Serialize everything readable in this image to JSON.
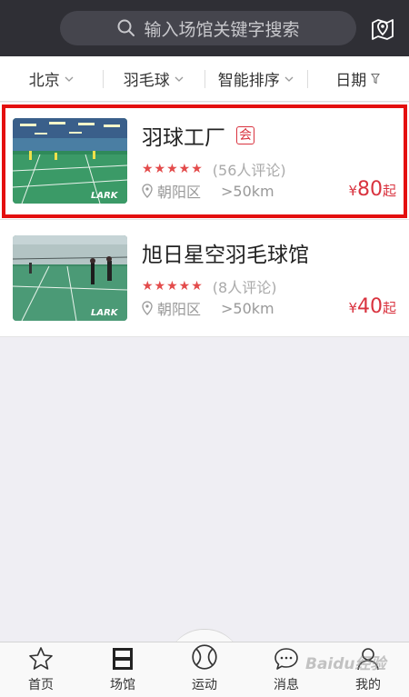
{
  "search": {
    "placeholder": "输入场馆关键字搜索",
    "icon": "search-icon"
  },
  "map_button": {
    "icon": "map-pin-icon"
  },
  "filters": [
    {
      "label": "北京",
      "icon": "chevron-down-icon"
    },
    {
      "label": "羽毛球",
      "icon": "chevron-down-icon"
    },
    {
      "label": "智能排序",
      "icon": "chevron-down-icon"
    },
    {
      "label": "日期",
      "icon": "filter-icon"
    }
  ],
  "venues": [
    {
      "name": "羽球工厂",
      "tag": "会",
      "stars": "★★★★★",
      "reviews": "(56人评论)",
      "district": "朝阳区",
      "distance": ">50km",
      "currency": "¥",
      "price": "80",
      "price_suffix": "起",
      "thumb_brand": "LARK"
    },
    {
      "name": "旭日星空羽毛球馆",
      "tag": "",
      "stars": "★★★★★",
      "reviews": "(8人评论)",
      "district": "朝阳区",
      "distance": ">50km",
      "currency": "¥",
      "price": "40",
      "price_suffix": "起",
      "thumb_brand": "LARK"
    }
  ],
  "tabs": [
    {
      "label": "首页",
      "icon": "star-icon"
    },
    {
      "label": "场馆",
      "icon": "court-icon"
    },
    {
      "label": "运动",
      "icon": "ball-icon"
    },
    {
      "label": "消息",
      "icon": "chat-icon"
    },
    {
      "label": "我的",
      "icon": "user-icon"
    }
  ],
  "watermark": "Baidu经验",
  "colors": {
    "header_bg": "#2f2f35",
    "accent_red": "#d9333f",
    "highlight_box": "#e40f0f"
  }
}
